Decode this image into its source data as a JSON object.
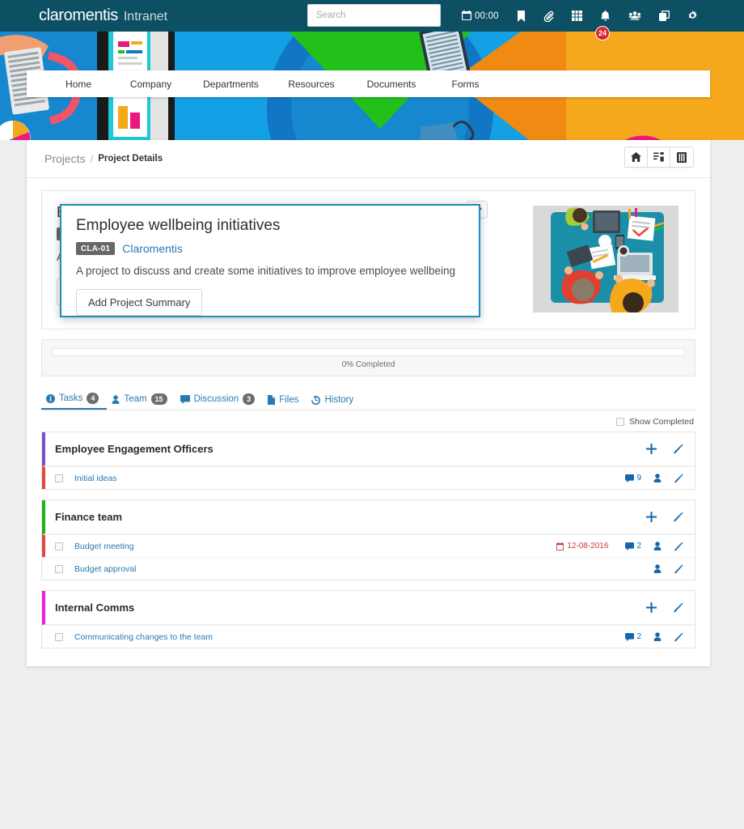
{
  "topbar": {
    "logo_main": "claromentis",
    "logo_sub": "Intranet",
    "search_placeholder": "Search",
    "search_value": "",
    "clock": "00:00",
    "notification_badge": "24",
    "icons": [
      {
        "name": "calendar-clock-icon",
        "label": "00:00"
      },
      {
        "name": "bookmark-icon",
        "label": "Bookmarks"
      },
      {
        "name": "paperclip-icon",
        "label": "Attachments"
      },
      {
        "name": "apps-grid-icon",
        "label": "Applications"
      },
      {
        "name": "bell-icon",
        "label": "Notifications"
      },
      {
        "name": "people-icon",
        "label": "People"
      },
      {
        "name": "copy-icon",
        "label": "Clipboard"
      },
      {
        "name": "gear-icon",
        "label": "Settings"
      }
    ]
  },
  "nav": {
    "items": [
      {
        "label": "Home"
      },
      {
        "label": "Company"
      },
      {
        "label": "Departments"
      },
      {
        "label": "Resources"
      },
      {
        "label": "Documents"
      },
      {
        "label": "Forms"
      }
    ]
  },
  "breadcrumb": {
    "root": "Projects",
    "separator": "/",
    "leaf": "Project Details",
    "actions": [
      {
        "name": "home-icon",
        "label": "Home"
      },
      {
        "name": "task-list-icon",
        "label": "Task list"
      },
      {
        "name": "archive-book-icon",
        "label": "Archive"
      }
    ]
  },
  "project": {
    "title": "Employee wellbeing initiatives",
    "code": "CLA-01",
    "client": "Claromentis",
    "description": "A project to discuss and create some initiatives to improve employee wellbeing",
    "summary_button": "Add Project Summary",
    "pin_icon": "pin-icon",
    "thumbnail_alt": "team-desk-illustration"
  },
  "popup": {
    "title": "Employee wellbeing initiatives",
    "code": "CLA-01",
    "client": "Claromentis",
    "description": "A project to discuss and create some initiatives to improve employee wellbeing",
    "summary_button": "Add Project Summary",
    "border_color": "#1b8cc4"
  },
  "progress": {
    "percent": 0,
    "label": "0% Completed"
  },
  "tabs": [
    {
      "label": "Tasks",
      "count": "4",
      "icon": "info-circle-icon",
      "active": true
    },
    {
      "label": "Team",
      "count": "15",
      "icon": "person-icon",
      "active": false
    },
    {
      "label": "Discussion",
      "count": "3",
      "icon": "comment-icon",
      "active": false
    },
    {
      "label": "Files",
      "count": "",
      "icon": "file-icon",
      "active": false
    },
    {
      "label": "History",
      "count": "",
      "icon": "history-icon",
      "active": false
    }
  ],
  "filters": {
    "show_completed_label": "Show Completed",
    "show_completed_checked": false
  },
  "task_groups": [
    {
      "title": "Employee Engagement Officers",
      "color": "#7c4ec4",
      "add_icon": "plus-icon",
      "edit_icon": "pencil-icon",
      "tasks": [
        {
          "name": "Initial ideas",
          "bar_color": "#e8453c",
          "due": "",
          "comments": "9",
          "assignee_icon": "person-icon",
          "edit_icon": "pencil-icon"
        }
      ]
    },
    {
      "title": "Finance team",
      "color": "#18b418",
      "add_icon": "plus-icon",
      "edit_icon": "pencil-icon",
      "tasks": [
        {
          "name": "Budget meeting",
          "bar_color": "#e8453c",
          "due": "12-08-2016",
          "comments": "2",
          "assignee_icon": "person-icon",
          "edit_icon": "pencil-icon"
        },
        {
          "name": "Budget approval",
          "bar_color": "transparent",
          "due": "",
          "comments": "",
          "assignee_icon": "person-icon",
          "edit_icon": "pencil-icon"
        }
      ]
    },
    {
      "title": "Internal Comms",
      "color": "#f41ce0",
      "add_icon": "plus-icon",
      "edit_icon": "pencil-icon",
      "tasks": [
        {
          "name": "Communicating changes to the team",
          "bar_color": "transparent",
          "due": "",
          "comments": "2",
          "assignee_icon": "person-icon",
          "edit_icon": "pencil-icon"
        }
      ]
    }
  ],
  "colors": {
    "topbar": "#0d4f63",
    "accent_link": "#2a7ab0",
    "action_blue": "#1565a8",
    "danger": "#cc3b3b",
    "page_bg": "#eeeeee"
  }
}
